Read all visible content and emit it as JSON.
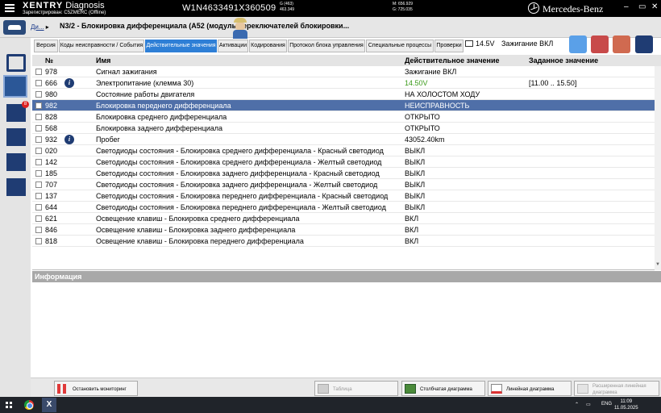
{
  "titlebar": {
    "brand": "XENTRY",
    "app": "Diagnosis",
    "registration": "Зарегистрирован: C5ZMERC (Offline)",
    "vin": "W1N4633491X360509",
    "g_label": "G (463)",
    "g_value": "463.349",
    "m_line": "M: 656.929",
    "g_line": "G: 725.035",
    "maker": "Mercedes-Benz",
    "ctl_min": "–",
    "ctl_max": "▭",
    "ctl_close": "✕"
  },
  "header": {
    "breadcrumb_link": "Ди...",
    "breadcrumb_sep": "▸",
    "title": "N3/2 - Блокировка дифференциала (A52 (модуль переключателей блокировки...",
    "battery_voltage": "14.5V",
    "ignition": "Зажигание ВКЛ"
  },
  "tabs": [
    {
      "label": "Версия"
    },
    {
      "label": "Коды неисправности / События"
    },
    {
      "label": "Действительные значения"
    },
    {
      "label": "Активации"
    },
    {
      "label": "Кодирования"
    },
    {
      "label": "Протокол блока управления"
    },
    {
      "label": "Специальные процессы"
    },
    {
      "label": "Проверки"
    }
  ],
  "table": {
    "columns": {
      "no": "№",
      "name": "Имя",
      "actual": "Действительное значение",
      "target": "Заданное значение"
    },
    "rows": [
      {
        "no": "978",
        "name": "Сигнал зажигания",
        "actual": "Зажигание ВКЛ",
        "target": ""
      },
      {
        "no": "666",
        "name": "Электропитание (клемма 30)",
        "actual": "14.50V",
        "target": "[11.00 .. 15.50]"
      },
      {
        "no": "980",
        "name": "Состояние работы двигателя",
        "actual": "НА ХОЛОСТОМ ХОДУ",
        "target": ""
      },
      {
        "no": "982",
        "name": "Блокировка переднего дифференциала",
        "actual": "НЕИСПРАВНОСТЬ",
        "target": ""
      },
      {
        "no": "828",
        "name": "Блокировка среднего дифференциала",
        "actual": "ОТКРЫТО",
        "target": ""
      },
      {
        "no": "568",
        "name": "Блокировка заднего дифференциала",
        "actual": "ОТКРЫТО",
        "target": ""
      },
      {
        "no": "932",
        "name": "Пробег",
        "actual": "43052.40km",
        "target": ""
      },
      {
        "no": "020",
        "name": "Светодиоды состояния - Блокировка среднего дифференциала - Красный светодиод",
        "actual": "ВЫКЛ",
        "target": ""
      },
      {
        "no": "142",
        "name": "Светодиоды состояния - Блокировка среднего дифференциала - Желтый светодиод",
        "actual": "ВЫКЛ",
        "target": ""
      },
      {
        "no": "185",
        "name": "Светодиоды состояния - Блокировка заднего дифференциала - Красный светодиод",
        "actual": "ВЫКЛ",
        "target": ""
      },
      {
        "no": "707",
        "name": "Светодиоды состояния - Блокировка заднего дифференциала - Желтый светодиод",
        "actual": "ВЫКЛ",
        "target": ""
      },
      {
        "no": "137",
        "name": "Светодиоды состояния - Блокировка переднего дифференциала - Красный светодиод",
        "actual": "ВЫКЛ",
        "target": ""
      },
      {
        "no": "644",
        "name": "Светодиоды состояния - Блокировка переднего дифференциала - Желтый светодиод",
        "actual": "ВЫКЛ",
        "target": ""
      },
      {
        "no": "621",
        "name": "Освещение клавиш - Блокировка среднего дифференциала",
        "actual": "ВКЛ",
        "target": ""
      },
      {
        "no": "846",
        "name": "Освещение клавиш - Блокировка заднего дифференциала",
        "actual": "ВКЛ",
        "target": ""
      },
      {
        "no": "818",
        "name": "Освещение клавиш - Блокировка переднего дифференциала",
        "actual": "ВКЛ",
        "target": ""
      }
    ]
  },
  "info_panel": {
    "title": "Информация"
  },
  "sidebar": {
    "badge": "8"
  },
  "bottom_bar": {
    "stop": "Остановить мониторинг",
    "table": "Таблица",
    "bar_chart": "Столбчатая диаграмма",
    "line_chart": "Линейная диаграмма",
    "extended_line": "Расширенная линейная диаграмма"
  },
  "taskbar": {
    "app_letter": "X",
    "lang": "ENG",
    "time": "11:09",
    "date": "11.05.2025"
  },
  "colors": {
    "accent": "#2e7fd6",
    "selected_row": "#4f6fa8",
    "nav": "#1f3c73",
    "ok_value": "#3a9a1a"
  }
}
